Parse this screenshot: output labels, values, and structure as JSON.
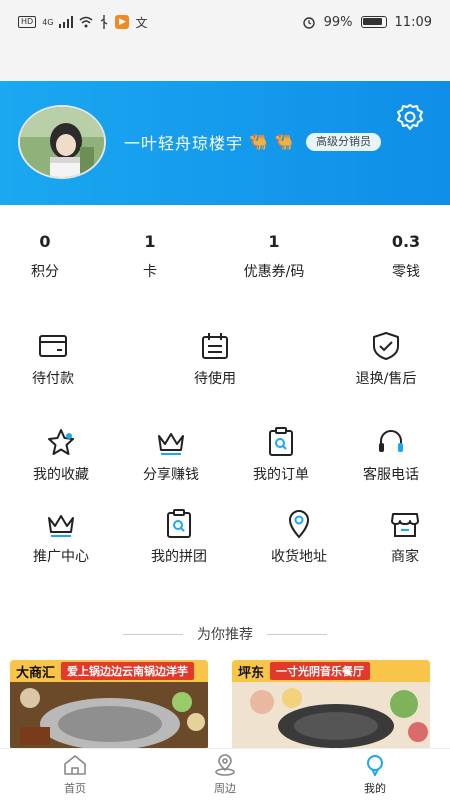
{
  "status_bar": {
    "left_badges": [
      "HD",
      "4G"
    ],
    "battery": "99%",
    "time": "11:09"
  },
  "profile": {
    "username": "一叶轻舟琼楼宇",
    "level_badge": "高级分销员"
  },
  "stats": [
    {
      "value": "0",
      "label": "积分"
    },
    {
      "value": "1",
      "label": "卡"
    },
    {
      "value": "1",
      "label": "优惠券/码"
    },
    {
      "value": "0.3",
      "label": "零钱"
    }
  ],
  "orders": [
    {
      "label": "待付款",
      "icon": "wallet-icon"
    },
    {
      "label": "待使用",
      "icon": "calendar-icon"
    },
    {
      "label": "退换/售后",
      "icon": "shield-check-icon"
    }
  ],
  "services": [
    {
      "label": "我的收藏",
      "icon": "star-icon"
    },
    {
      "label": "分享赚钱",
      "icon": "crown-icon"
    },
    {
      "label": "我的订单",
      "icon": "order-search-icon"
    },
    {
      "label": "客服电话",
      "icon": "headset-icon"
    },
    {
      "label": "推广中心",
      "icon": "crown-icon"
    },
    {
      "label": "我的拼团",
      "icon": "group-search-icon"
    },
    {
      "label": "收货地址",
      "icon": "location-icon"
    },
    {
      "label": "商家",
      "icon": "store-icon"
    }
  ],
  "recommend": {
    "title": "为你推荐",
    "cards": [
      {
        "tag": "大商汇",
        "text": "爱上锅边边云南锅边洋芋"
      },
      {
        "tag": "坪东",
        "text": "一寸光阴音乐餐厅"
      }
    ]
  },
  "bottom_nav": [
    {
      "label": "首页",
      "icon": "home-icon"
    },
    {
      "label": "周边",
      "icon": "nearby-icon"
    },
    {
      "label": "我的",
      "icon": "profile-icon"
    }
  ],
  "colors": {
    "primary": "#1aa8f0",
    "accent_red": "#e23a2a"
  }
}
